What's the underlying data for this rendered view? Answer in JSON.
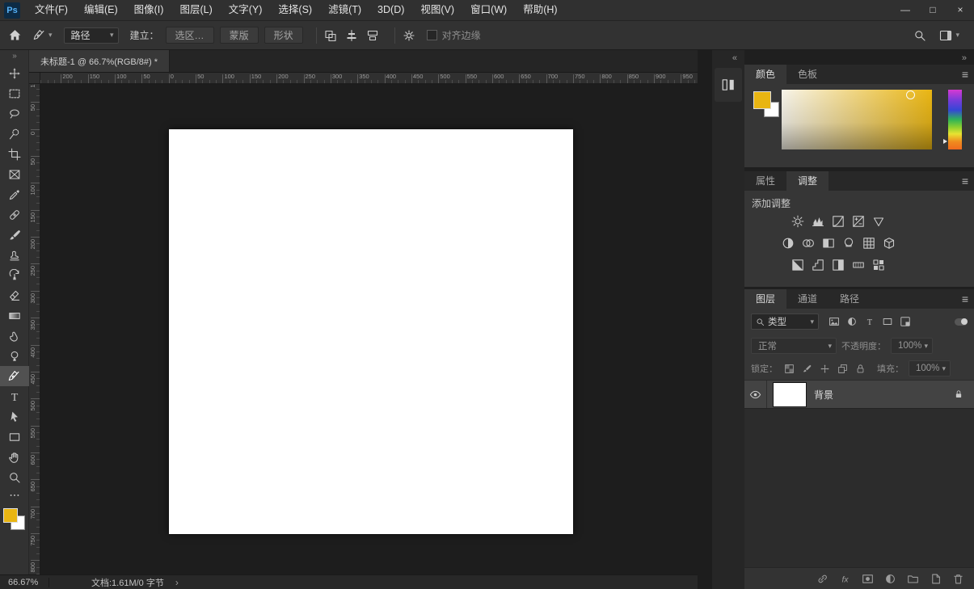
{
  "titlebar": {
    "logo": "Ps",
    "menus": [
      "文件(F)",
      "编辑(E)",
      "图像(I)",
      "图层(L)",
      "文字(Y)",
      "选择(S)",
      "滤镜(T)",
      "3D(D)",
      "视图(V)",
      "窗口(W)",
      "帮助(H)"
    ],
    "window_controls": [
      {
        "name": "minimize-button",
        "glyph": "—"
      },
      {
        "name": "maximize-button",
        "glyph": "□"
      },
      {
        "name": "close-button",
        "glyph": "×"
      }
    ]
  },
  "options_bar": {
    "tool_mode_select": {
      "value": "路径"
    },
    "make_label": "建立：",
    "make_buttons": [
      "选区…",
      "蒙版",
      "形状"
    ],
    "align_edges_label": "对齐边缘",
    "align_edges_checked": false
  },
  "toolbar": {
    "collapse_glyph": "»",
    "tools": [
      {
        "name": "move-tool"
      },
      {
        "name": "rectangular-marquee-tool"
      },
      {
        "name": "lasso-tool"
      },
      {
        "name": "quick-selection-tool"
      },
      {
        "name": "crop-tool"
      },
      {
        "name": "frame-tool"
      },
      {
        "name": "eyedropper-tool"
      },
      {
        "name": "healing-brush-tool"
      },
      {
        "name": "brush-tool"
      },
      {
        "name": "clone-stamp-tool"
      },
      {
        "name": "history-brush-tool"
      },
      {
        "name": "eraser-tool"
      },
      {
        "name": "gradient-tool"
      },
      {
        "name": "smudge-tool"
      },
      {
        "name": "dodge-tool"
      },
      {
        "name": "pen-tool",
        "selected": true
      },
      {
        "name": "type-tool"
      },
      {
        "name": "path-selection-tool"
      },
      {
        "name": "rectangle-tool"
      },
      {
        "name": "hand-tool"
      },
      {
        "name": "zoom-tool"
      }
    ],
    "foreground_color": "#e9b512",
    "background_color": "#ffffff"
  },
  "document": {
    "tab_title": "未标题-1 @ 66.7%(RGB/8#) *"
  },
  "rulers": {
    "horizontal": [
      "0",
      "200",
      "150",
      "100",
      "50",
      "0",
      "50",
      "100",
      "150",
      "200",
      "250",
      "300",
      "350",
      "400",
      "450",
      "500",
      "550",
      "600",
      "650",
      "700",
      "750",
      "800",
      "850",
      "900",
      "950"
    ],
    "vertical": [
      "100",
      "50",
      "0",
      "50",
      "100",
      "150",
      "200",
      "250",
      "300",
      "350",
      "400",
      "450",
      "500",
      "550",
      "600",
      "650",
      "700",
      "750",
      "800"
    ]
  },
  "status_bar": {
    "zoom": "66.67%",
    "doc_info": "文档:1.61M/0 字节",
    "chevron": "›"
  },
  "dock": {
    "expand_chevron": "«",
    "collapse_chevron": "»"
  },
  "panels": {
    "color": {
      "tabs": [
        {
          "label": "颜色",
          "active": true
        },
        {
          "label": "色板",
          "active": false
        }
      ],
      "foreground_color": "#e9b512",
      "background_color": "#ffffff"
    },
    "adjustments": {
      "tabs": [
        {
          "label": "属性",
          "active": false
        },
        {
          "label": "调整",
          "active": true
        }
      ],
      "add_label": "添加调整",
      "icon_rows": [
        [
          "brightness-contrast-icon",
          "levels-icon",
          "curves-icon",
          "exposure-icon",
          "vibrance-icon"
        ],
        [
          "hue-saturation-icon",
          "color-balance-icon",
          "black-white-icon",
          "photo-filter-icon",
          "channel-mixer-icon",
          "color-lookup-icon"
        ],
        [
          "invert-icon",
          "posterize-icon",
          "threshold-icon",
          "gradient-map-icon",
          "selective-color-icon"
        ]
      ]
    },
    "layers": {
      "tabs": [
        {
          "label": "图层",
          "active": true
        },
        {
          "label": "通道",
          "active": false
        },
        {
          "label": "路径",
          "active": false
        }
      ],
      "filter_select_value": "类型",
      "filter_icons": [
        "filter-pixel-layers-icon",
        "filter-adjustment-layers-icon",
        "filter-type-layers-icon",
        "filter-shape-layers-icon",
        "filter-smart-objects-icon"
      ],
      "blend_mode_value": "正常",
      "opacity_label": "不透明度：",
      "opacity_value": "100%",
      "lock_label": "锁定：",
      "lock_icons": [
        "lock-transparency-icon",
        "lock-pixels-icon",
        "lock-position-icon",
        "lock-artboard-icon",
        "lock-all-icon"
      ],
      "fill_label": "填充：",
      "fill_value": "100%",
      "layers": [
        {
          "name": "背景",
          "visible": true,
          "locked": true
        }
      ],
      "bottom_icons": [
        "link-layers-icon",
        "layer-style-icon",
        "add-mask-icon",
        "new-adjustment-layer-icon",
        "new-group-icon",
        "new-layer-icon",
        "delete-layer-icon"
      ]
    }
  }
}
